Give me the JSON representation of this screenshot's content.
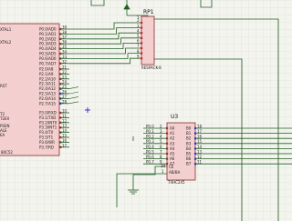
{
  "colors": {
    "canvas": "#f4f4ef",
    "grid": "#d8d8d0",
    "wire": "#1f5f22",
    "chip_fill": "#f3d0cf",
    "chip_border": "#8a2a2a",
    "pin_text": "#202020",
    "pin_dot": "#cc2222",
    "pin_dot_alt": "#2233cc",
    "cursor": "#3a3acc"
  },
  "mcu": {
    "left_labels": [
      "XTAL1",
      "XTAL2",
      "RST",
      "PSEN",
      "ALE",
      "EA"
    ],
    "p0": [
      "P0.0/AD0",
      "P0.1/AD1",
      "P0.2/AD2",
      "P0.3/AD3",
      "P0.4/AD4",
      "P0.5/AD5",
      "P0.6/AD6",
      "P0.7/AD7"
    ],
    "p0_nums": [
      "39",
      "38",
      "37",
      "36",
      "35",
      "34",
      "33",
      "32"
    ],
    "p2": [
      "P2.0/A8",
      "P2.1/A9",
      "P2.2/A10",
      "P2.3/A11",
      "P2.4/A12",
      "P2.5/A13",
      "P2.6/A14",
      "P2.7/A15"
    ],
    "p2_nums": [
      "21",
      "22",
      "23",
      "24",
      "25",
      "26",
      "27",
      "28"
    ],
    "p3": [
      "P3.0/RXD",
      "P3.1/TXD",
      "P3.2/INT0",
      "P3.3/INT1",
      "P3.4/T0",
      "P3.5/T1",
      "P3.6/WR",
      "P3.7/RD"
    ],
    "p3_nums": [
      "10",
      "11",
      "12",
      "13",
      "14",
      "15",
      "16",
      "17"
    ],
    "p1_left": [
      "T2",
      "T2EX",
      "",
      "",
      "",
      "",
      "",
      ""
    ],
    "part": "80C52"
  },
  "rp1": {
    "ref": "RP1",
    "type": "RESPACK-8",
    "pins": [
      "2",
      "3",
      "4",
      "5",
      "6",
      "7",
      "8",
      "9"
    ],
    "top_pin": "1"
  },
  "u3": {
    "ref": "U3",
    "type": "74HC245",
    "left_pins": [
      "A0",
      "A1",
      "A2",
      "A3",
      "A4",
      "A5",
      "A6",
      "A7"
    ],
    "left_nums": [
      "2",
      "3",
      "4",
      "5",
      "6",
      "7",
      "8",
      "9"
    ],
    "right_pins": [
      "B0",
      "B1",
      "B2",
      "B3",
      "B4",
      "B5",
      "B6",
      "B7"
    ],
    "right_nums": [
      "18",
      "17",
      "16",
      "15",
      "14",
      "13",
      "12",
      "11"
    ],
    "net_labels": [
      "P0.0",
      "P0.1",
      "P0.2",
      "P0.3",
      "P0.4",
      "P0.5",
      "P0.6",
      "P0.7"
    ],
    "ce": "CE",
    "ab": "AB/BA",
    "ce_num": "19",
    "ab_num": "1"
  }
}
